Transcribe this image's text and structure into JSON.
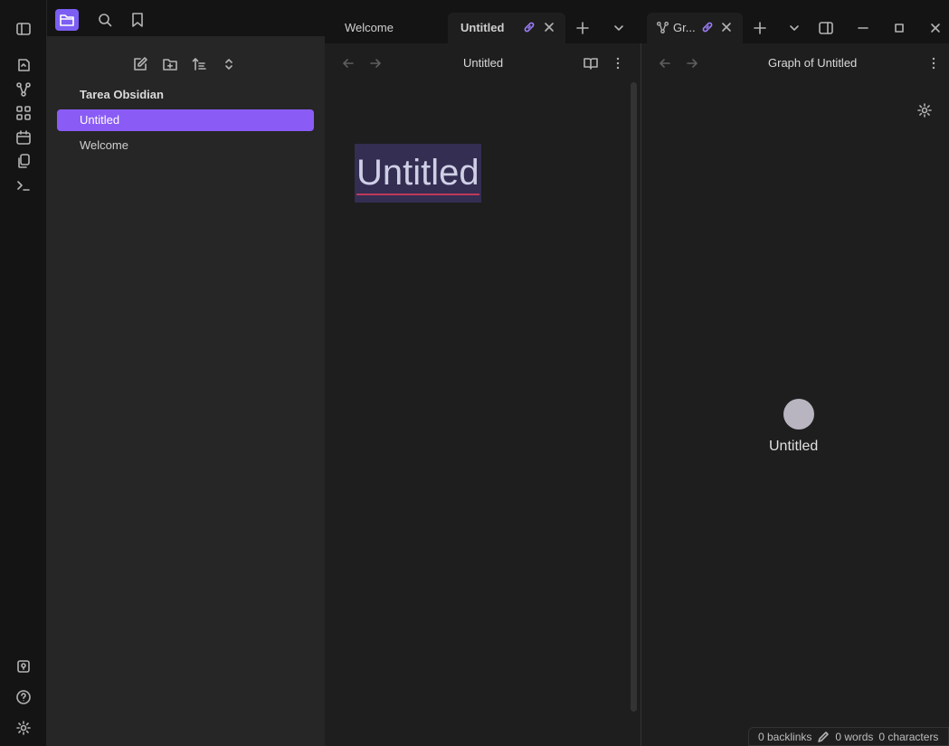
{
  "sidebar": {
    "vault_name": "Tarea Obsidian",
    "files": [
      {
        "label": "Untitled",
        "active": true
      },
      {
        "label": "Welcome",
        "active": false
      }
    ]
  },
  "tabs": {
    "left": [
      {
        "label": "Welcome",
        "active": false
      },
      {
        "label": "Untitled",
        "active": true
      }
    ],
    "right": [
      {
        "label": "Gr...",
        "active": true
      }
    ]
  },
  "editor": {
    "header_title": "Untitled",
    "note_title": "Untitled"
  },
  "graph": {
    "header_title": "Graph of Untitled",
    "node_label": "Untitled"
  },
  "status": {
    "backlinks": "0 backlinks",
    "words": "0 words",
    "characters": "0 characters"
  },
  "colors": {
    "accent": "#8a5cf5",
    "background": "#1e1e1e",
    "sidebar": "#262626",
    "ribbon": "#141414"
  }
}
